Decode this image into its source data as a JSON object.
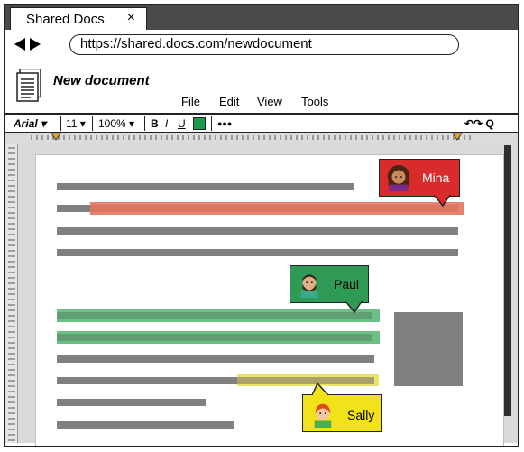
{
  "browser": {
    "tab_title": "Shared Docs",
    "tab_close": "×",
    "url": "https://shared.docs.com/newdocument"
  },
  "document": {
    "title": "New document"
  },
  "menu": [
    "File",
    "Edit",
    "View",
    "Tools"
  ],
  "toolbar": {
    "font": "Arial",
    "font_size": "11",
    "zoom": "100%",
    "bold": "B",
    "italic": "I",
    "underline": "U",
    "text_color": "#1a9a4a",
    "more": "●●●",
    "undo_redo_search": "↶↷ Q"
  },
  "comments": [
    {
      "name": "Mina",
      "color": "#d92b2b",
      "highlight": "#e2735e"
    },
    {
      "name": "Paul",
      "color": "#2f9a55",
      "highlight": "#6cbf85"
    },
    {
      "name": "Sally",
      "color": "#f2e21a",
      "highlight": "#ece46a"
    }
  ],
  "icons": {
    "document": "document-icon",
    "back": "back-arrow-icon",
    "forward": "forward-arrow-icon"
  }
}
